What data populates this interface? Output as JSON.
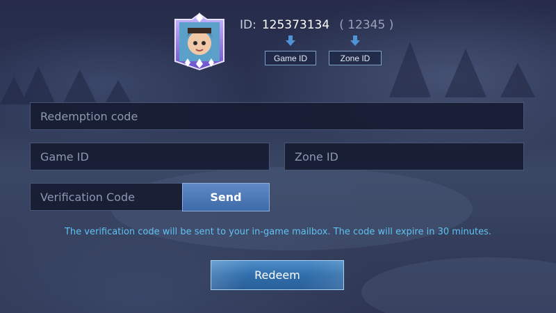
{
  "profile": {
    "id_label": "ID:",
    "game_id": "125373134",
    "zone_id_display": "( 12345 )",
    "game_id_tag": "Game ID",
    "zone_id_tag": "Zone ID"
  },
  "form": {
    "redemption_code_placeholder": "Redemption code",
    "game_id_placeholder": "Game ID",
    "zone_id_placeholder": "Zone ID",
    "verification_code_placeholder": "Verification Code",
    "send_label": "Send"
  },
  "note": "The verification code will be sent to your in-game mailbox. The code will expire in 30 minutes.",
  "redeem_label": "Redeem",
  "colors": {
    "accent": "#5fc2f4",
    "button": "#3d6aa8",
    "field_bg": "#161c32"
  }
}
